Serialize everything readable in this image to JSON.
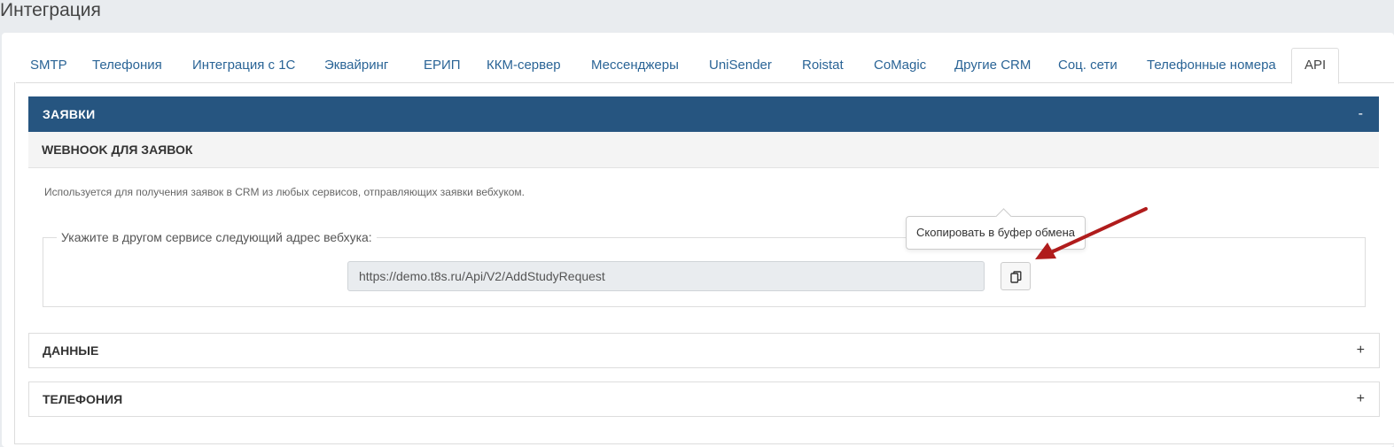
{
  "page": {
    "title": "Интеграция"
  },
  "tabs": [
    {
      "label": "SMTP"
    },
    {
      "label": "Телефония"
    },
    {
      "label": "Интеграция с 1С"
    },
    {
      "label": "Эквайринг"
    },
    {
      "label": "ЕРИП"
    },
    {
      "label": "ККМ-сервер"
    },
    {
      "label": "Мессенджеры"
    },
    {
      "label": "UniSender"
    },
    {
      "label": "Roistat"
    },
    {
      "label": "CoMagic"
    },
    {
      "label": "Другие CRM"
    },
    {
      "label": "Соц. сети"
    },
    {
      "label": "Телефонные номера"
    },
    {
      "label": "API",
      "active": true
    }
  ],
  "requests_panel": {
    "title": "ЗАЯВКИ",
    "toggle": "-",
    "webhook": {
      "title": "WEBHOOK ДЛЯ ЗАЯВОК",
      "description": "Используется для получения заявок в CRM из любых сервисов, отправляющих заявки вебхуком.",
      "legend": "Укажите в другом сервисе следующий адрес вебхука:",
      "url": "https://demo.t8s.ru/Api/V2/AddStudyRequest",
      "copy_icon": "copy-icon",
      "tooltip": "Скопировать в буфер обмена"
    }
  },
  "data_panel": {
    "title": "ДАННЫЕ",
    "toggle": "+"
  },
  "telephony_panel": {
    "title": "ТЕЛЕФОНИЯ",
    "toggle": "+"
  },
  "colors": {
    "panel_header": "#265580",
    "link": "#2a6496",
    "arrow": "#b01c1c"
  }
}
